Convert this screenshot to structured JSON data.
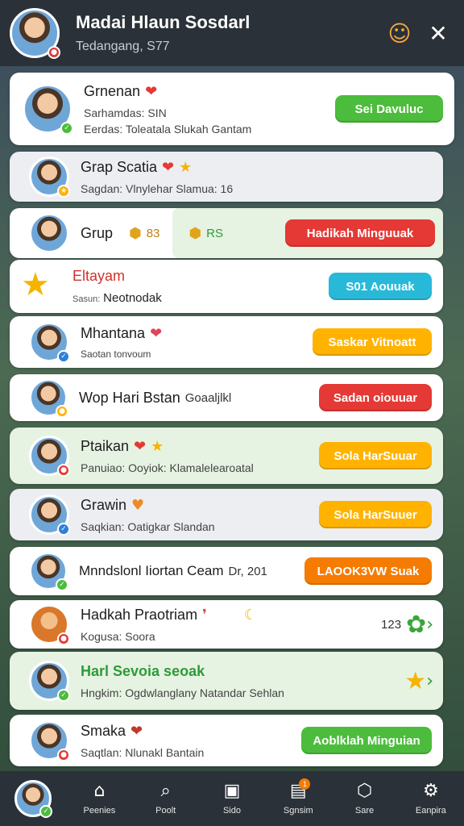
{
  "header": {
    "title": "Madai Hlaun Sosdarl",
    "subtitle": "Tedangang, S77",
    "avatar_status": "red",
    "icons": [
      "mascot-icon",
      "pin-off-icon"
    ]
  },
  "rows": [
    {
      "name": "Grnenan",
      "sub": "Sarhamdas: SIN",
      "sub2": "Eerdas: Toleatala  Slukah Gantam",
      "button": "Sei Davuluc",
      "button_color": "green",
      "badge_icon": "sticker-icon"
    },
    {
      "name": "Grap Scatia",
      "sub": "Sagdan: Vlnylehar Slamua: 16",
      "badge_icon": "star-icon"
    },
    {
      "name": "Grup",
      "points_1": "83",
      "points_2": "RS",
      "button": "Hadikah Minguuak",
      "button_color": "red"
    },
    {
      "name": "Eltayam",
      "sub_label": "Sasun:",
      "sub": "Neotnodak",
      "button": "S01 Aouuak",
      "button_color": "cyan"
    },
    {
      "name": "Mhantana",
      "sub": "Saotan tonvoum",
      "button": "Saskar Vitnoatt",
      "button_color": "yellow"
    },
    {
      "name": "Wop Hari Bstan",
      "name_tail": "Goaaljlkl",
      "button": "Sadan oiouuar",
      "button_color": "red"
    },
    {
      "name": "Ptaikan",
      "sub": "Panuiao: Ooyiok: Klamalelearoatal",
      "button": "Sola HarSuuar",
      "button_color": "yellow"
    },
    {
      "name": "Grawin",
      "sub": "Saqkian:  Oatigkar Slandan",
      "button": "Sola HarSuuer",
      "button_color": "yellow"
    },
    {
      "name": "Mnndslonl Iiortan Ceam",
      "name_tail": "Dr, 201",
      "button": "LAOOK3VW Suak",
      "button_color": "orange"
    },
    {
      "name": "Hadkah Praotriam",
      "sub": "Kogusa: Soora",
      "count": "123"
    },
    {
      "name": "Harl Sevoia seoak",
      "sub": "Hngkim: Ogdwlanglany Natandar Sehlan"
    },
    {
      "name": "Smaka",
      "sub": "Saqtlan: Nlunakl Bantain",
      "button": "Aoblklah Minguian",
      "button_color": "green"
    }
  ],
  "bottom_nav": [
    {
      "label": "",
      "icon": "avatar"
    },
    {
      "label": "Peenies",
      "icon": "home-icon"
    },
    {
      "label": "Poolt",
      "icon": "search-icon"
    },
    {
      "label": "Sido",
      "icon": "frame-icon"
    },
    {
      "label": "Sgnsim",
      "icon": "inbox-icon",
      "badge": "1"
    },
    {
      "label": "Sare",
      "icon": "cube-icon"
    },
    {
      "label": "Eanpira",
      "icon": "gear-icon"
    }
  ]
}
